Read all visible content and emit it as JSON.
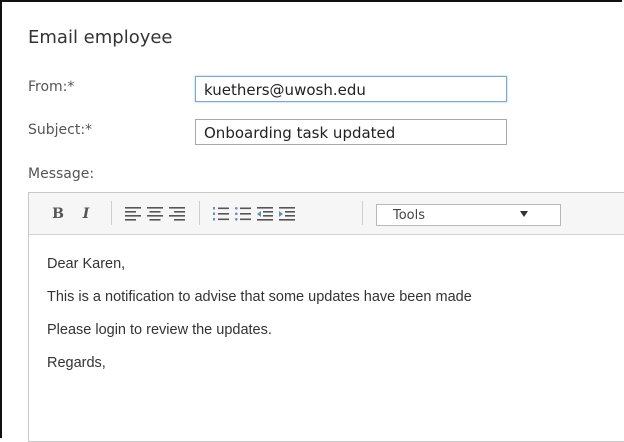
{
  "dialog": {
    "title": "Email employee"
  },
  "form": {
    "from_label": "From:*",
    "from_value": "kuethers@uwosh.edu",
    "subject_label": "Subject:*",
    "subject_value": "Onboarding task updated",
    "message_label": "Message:"
  },
  "toolbar": {
    "bold_label": "B",
    "italic_label": "I",
    "tools_selected": "Tools",
    "icons": [
      "bold-icon",
      "italic-icon",
      "align-left-icon",
      "align-center-icon",
      "align-right-icon",
      "ordered-list-icon",
      "unordered-list-icon",
      "outdent-icon",
      "indent-icon",
      "chevron-down-icon"
    ]
  },
  "message": {
    "line1": "Dear Karen,",
    "line2": "This is a notification to advise that some updates have been made",
    "line3": "Please login to review the updates.",
    "line4": "Regards,"
  },
  "colors": {
    "focus_border": "#7aa7d8",
    "toolbar_bg": "#f6f6f6",
    "text": "#333333"
  }
}
